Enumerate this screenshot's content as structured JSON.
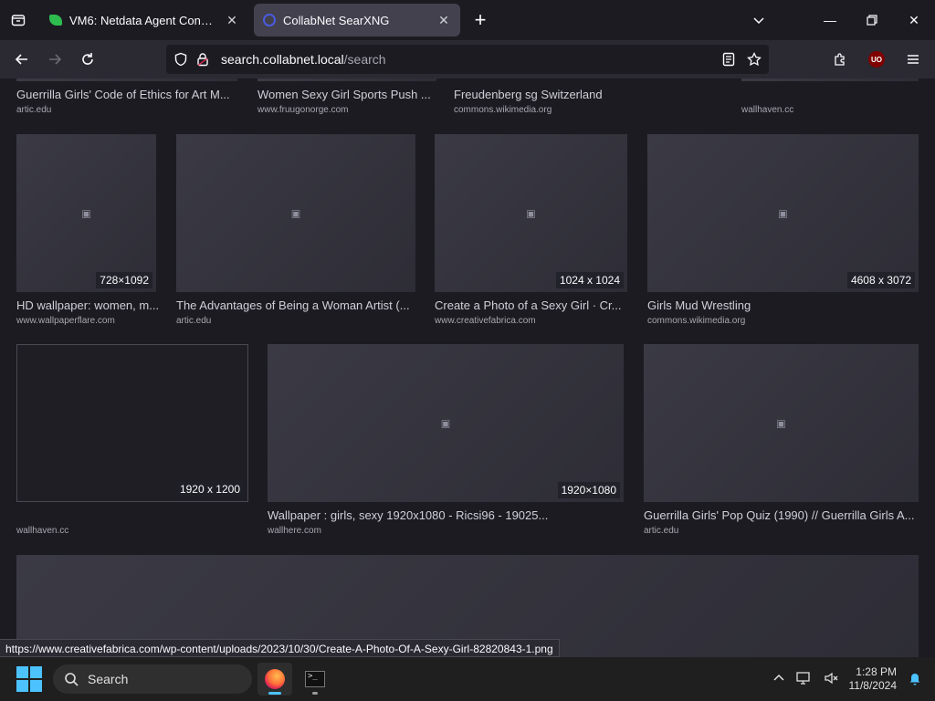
{
  "tabs": [
    {
      "title": "VM6: Netdata Agent Console",
      "active": false
    },
    {
      "title": "CollabNet SearXNG",
      "active": true
    }
  ],
  "url": {
    "host": "search.collabnet.local",
    "path": "/search"
  },
  "results": [
    {
      "title": "Guerrilla Girls' Code of Ethics for Art M...",
      "source": "artic.edu",
      "dims": ""
    },
    {
      "title": "Women Sexy Girl Sports Push ...",
      "source": "www.fruugonorge.com",
      "dims": ""
    },
    {
      "title": "Freudenberg sg Switzerland",
      "source": "commons.wikimedia.org",
      "dims": ""
    },
    {
      "title": "",
      "source": "wallhaven.cc",
      "dims": ""
    },
    {
      "title": "HD wallpaper: women, m...",
      "source": "www.wallpaperflare.com",
      "dims": "728×1092"
    },
    {
      "title": "The Advantages of Being a Woman Artist (...",
      "source": "artic.edu",
      "dims": ""
    },
    {
      "title": "Create a Photo of a Sexy Girl · Cr...",
      "source": "www.creativefabrica.com",
      "dims": "1024 x 1024"
    },
    {
      "title": "Girls Mud Wrestling",
      "source": "commons.wikimedia.org",
      "dims": "4608 x 3072"
    },
    {
      "title": "",
      "source": "wallhaven.cc",
      "dims": "1920 x 1200"
    },
    {
      "title": "Wallpaper : girls, sexy 1920x1080 - Ricsi96 - 19025...",
      "source": "wallhere.com",
      "dims": "1920×1080"
    },
    {
      "title": "Guerrilla Girls' Pop Quiz (1990) // Guerrilla Girls A...",
      "source": "artic.edu",
      "dims": ""
    }
  ],
  "status_url": "https://www.creativefabrica.com/wp-content/uploads/2023/10/30/Create-A-Photo-Of-A-Sexy-Girl-82820843-1.png",
  "taskbar": {
    "search_label": "Search",
    "time": "1:28 PM",
    "date": "11/8/2024"
  }
}
